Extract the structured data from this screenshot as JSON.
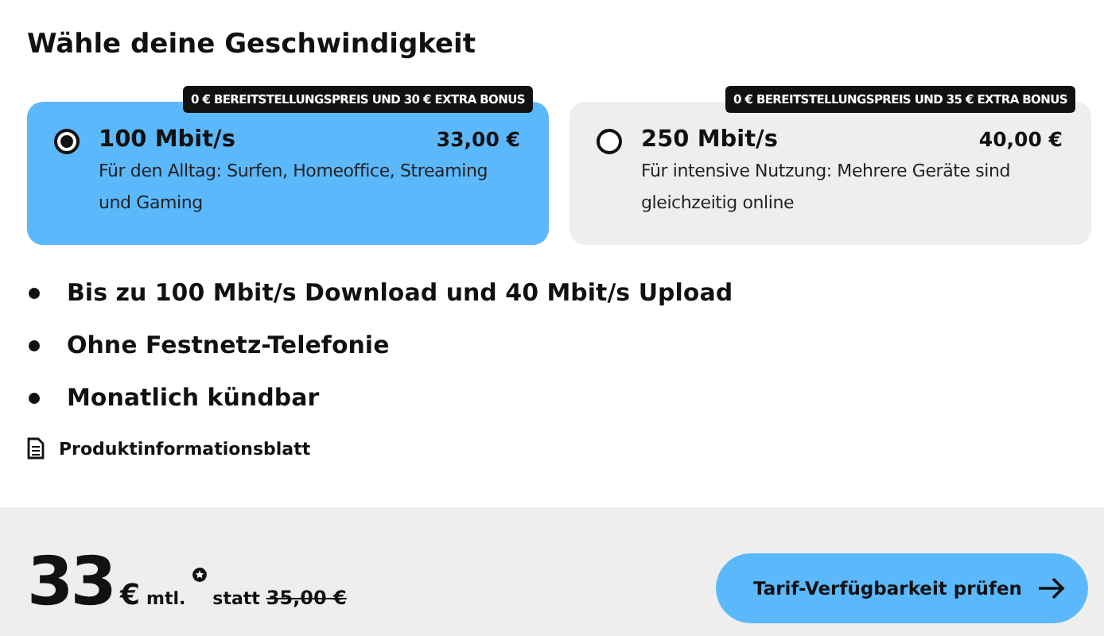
{
  "heading": "Wähle deine Geschwindigkeit",
  "plans": [
    {
      "badge": "0 € BEREITSTELLUNGSPREIS UND 30 € EXTRA BONUS",
      "speed": "100 Mbit/s",
      "price": "33,00 €",
      "description": "Für den Alltag: Surfen, Homeoffice, Streaming und Gaming",
      "selected": true
    },
    {
      "badge": "0 € BEREITSTELLUNGSPREIS UND 35 € EXTRA BONUS",
      "speed": "250 Mbit/s",
      "price": "40,00 €",
      "description": "Für intensive Nutzung: Mehrere Geräte sind gleichzeitig online",
      "selected": false
    }
  ],
  "features": [
    "Bis zu 100 Mbit/s Download und 40 Mbit/s Upload",
    "Ohne Festnetz-Telefonie",
    "Monatlich kündbar"
  ],
  "document_link": "Produktinformationsblatt",
  "footer": {
    "price": "33",
    "currency": "€",
    "period": "mtl.",
    "instead_label": "statt",
    "old_price": "35,00 €",
    "button": "Tarif-Verfügbarkeit prüfen"
  }
}
